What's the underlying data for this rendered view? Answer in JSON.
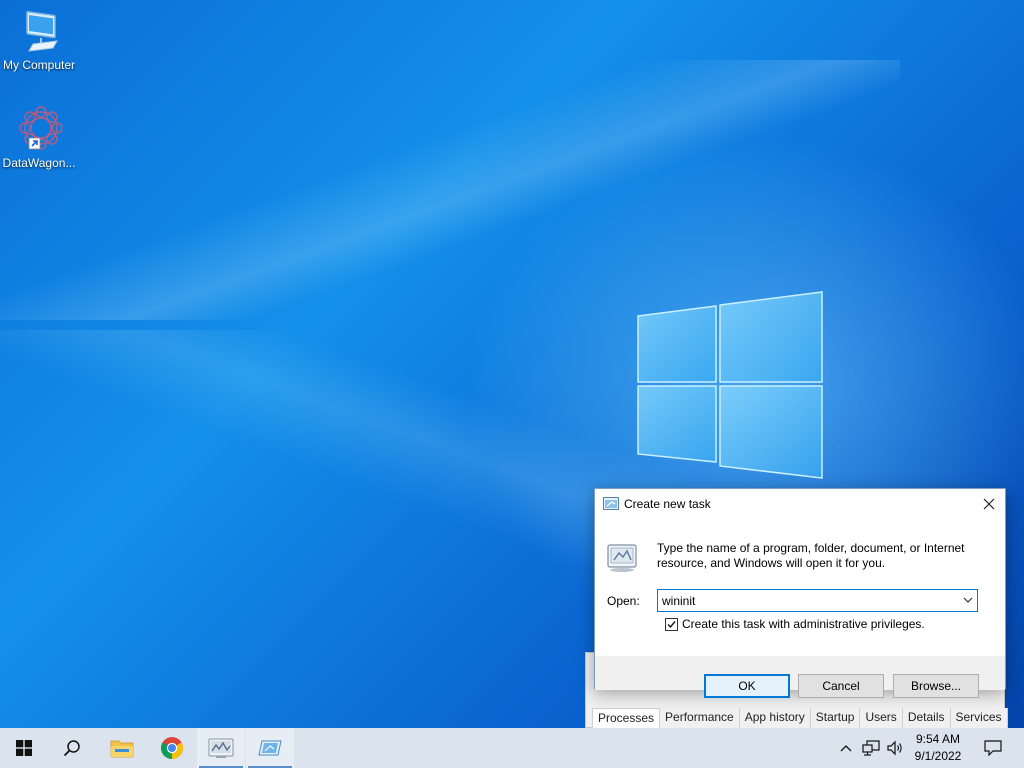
{
  "desktop": {
    "icons": [
      {
        "label": "My Computer",
        "icon": "monitor-icon"
      },
      {
        "label": "DataWagon...",
        "icon": "datawagon-shortcut-icon"
      }
    ]
  },
  "taskmgr": {
    "tabs": [
      "Processes",
      "Performance",
      "App history",
      "Startup",
      "Users",
      "Details",
      "Services"
    ]
  },
  "dialog": {
    "title": "Create new task",
    "description": "Type the name of a program, folder, document, or Internet resource, and Windows will open it for you.",
    "open_label": "Open:",
    "open_value": "wininit",
    "admin_checkbox_label": "Create this task with administrative privileges.",
    "admin_checked": true,
    "ok_label": "OK",
    "cancel_label": "Cancel",
    "browse_label": "Browse..."
  },
  "taskbar": {
    "pinned": [
      "start-icon",
      "search-icon",
      "file-explorer-icon",
      "chrome-icon",
      "task-manager-icon",
      "run-dialog-icon"
    ],
    "clock_time": "9:54 AM",
    "clock_date": "9/1/2022"
  },
  "colors": {
    "accent": "#0078d7",
    "taskbar": "#dbe4ee",
    "desktop_blue": "#1390ea"
  }
}
